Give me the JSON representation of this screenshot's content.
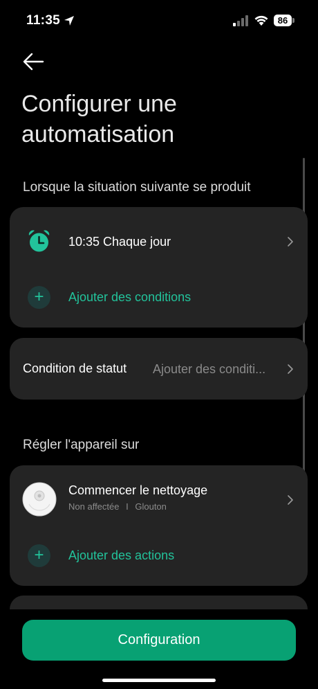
{
  "status_bar": {
    "time": "11:35",
    "battery": "86"
  },
  "header": {
    "title": "Configurer une automatisation"
  },
  "trigger_section": {
    "label": "Lorsque la situation suivante se produit",
    "trigger_text": "10:35 Chaque jour",
    "add_conditions_label": "Ajouter des conditions"
  },
  "status_condition": {
    "label": "Condition de statut",
    "value": "Ajouter des conditi..."
  },
  "action_section": {
    "label": "Régler l'appareil sur",
    "action_title": "Commencer le nettoyage",
    "action_room": "Non affectée",
    "action_separator": "I",
    "action_device": "Glouton",
    "add_actions_label": "Ajouter des actions"
  },
  "footer": {
    "button_label": "Configuration"
  },
  "colors": {
    "accent": "#22c39b",
    "button": "#08a173",
    "card": "#242424"
  },
  "icons": [
    "location-arrow-icon",
    "signal-icon",
    "wifi-icon",
    "back-arrow-icon",
    "alarm-clock-icon",
    "plus-icon",
    "chevron-right-icon",
    "robot-vacuum-icon"
  ]
}
